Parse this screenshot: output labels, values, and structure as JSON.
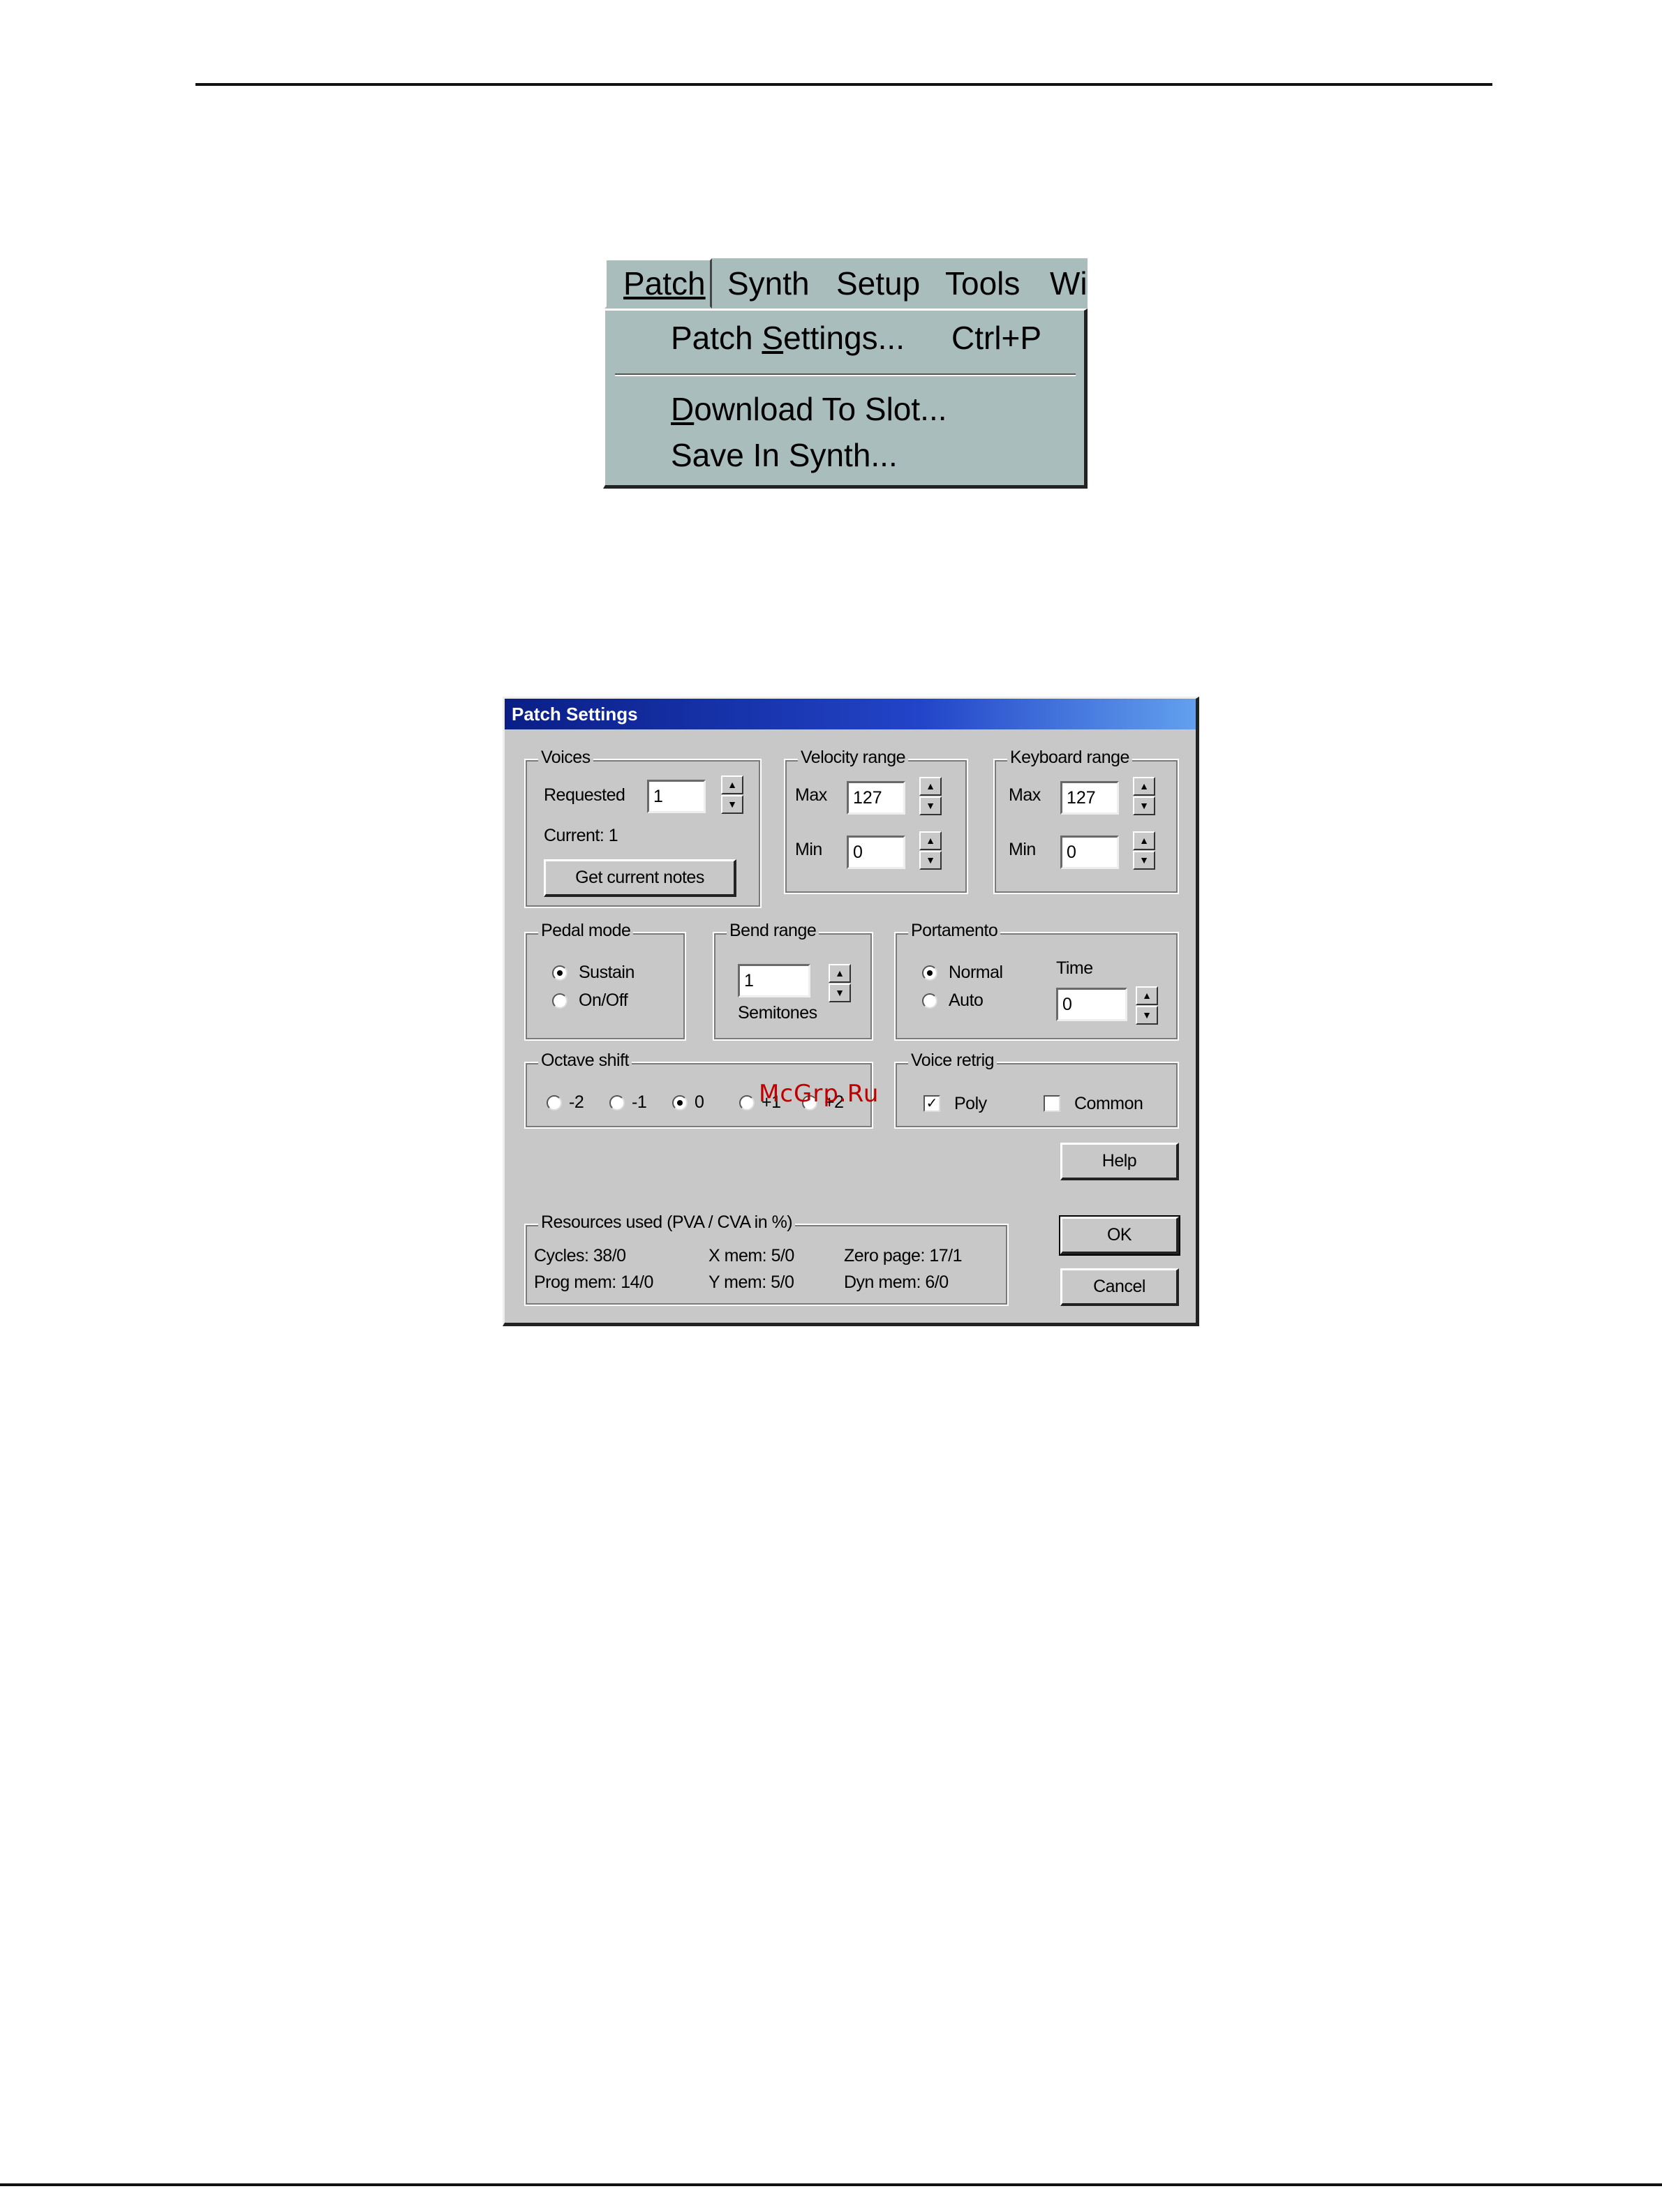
{
  "menu": {
    "bar_items": [
      "Patch",
      "Synth",
      "Setup",
      "Tools",
      "Wi"
    ],
    "dropdown": {
      "patch_settings": {
        "label_pre": "Patch ",
        "label_u": "S",
        "label_post": "ettings...",
        "shortcut": "Ctrl+P"
      },
      "download_to_slot": {
        "label_u": "D",
        "label_post": "ownload To Slot..."
      },
      "save_in_synth": {
        "label": "Save In Synth..."
      }
    }
  },
  "dialog": {
    "title": "Patch Settings",
    "voices": {
      "group_label": "Voices",
      "requested_label": "Requested",
      "requested_value": "1",
      "current_text": "Current: 1",
      "get_notes_button": "Get current notes"
    },
    "velocity": {
      "group_label": "Velocity range",
      "max_label": "Max",
      "max_value": "127",
      "min_label": "Min",
      "min_value": "0"
    },
    "keyboard": {
      "group_label": "Keyboard range",
      "max_label": "Max",
      "max_value": "127",
      "min_label": "Min",
      "min_value": "0"
    },
    "pedal": {
      "group_label": "Pedal mode",
      "options": [
        "Sustain",
        "On/Off"
      ],
      "selected": "Sustain"
    },
    "bend": {
      "group_label": "Bend range",
      "value": "1",
      "unit_label": "Semitones"
    },
    "portamento": {
      "group_label": "Portamento",
      "options": [
        "Normal",
        "Auto"
      ],
      "selected": "Normal",
      "time_label": "Time",
      "time_value": "0"
    },
    "octave": {
      "group_label": "Octave shift",
      "options": [
        "-2",
        "-1",
        "0",
        "+1",
        "+2"
      ],
      "selected": "0"
    },
    "voice_retrig": {
      "group_label": "Voice retrig",
      "poly_label": "Poly",
      "poly_checked": true,
      "common_label": "Common",
      "common_checked": false
    },
    "buttons": {
      "help": "Help",
      "ok": "OK",
      "cancel": "Cancel"
    },
    "resources": {
      "group_label": "Resources used (PVA / CVA in %)",
      "cycles": "Cycles: 38/0",
      "prog_mem": "Prog mem: 14/0",
      "x_mem": "X mem: 5/0",
      "y_mem": "Y mem: 5/0",
      "zero_page": "Zero page: 17/1",
      "dyn_mem": "Dyn mem: 6/0"
    }
  },
  "watermark": "McGrp.Ru"
}
